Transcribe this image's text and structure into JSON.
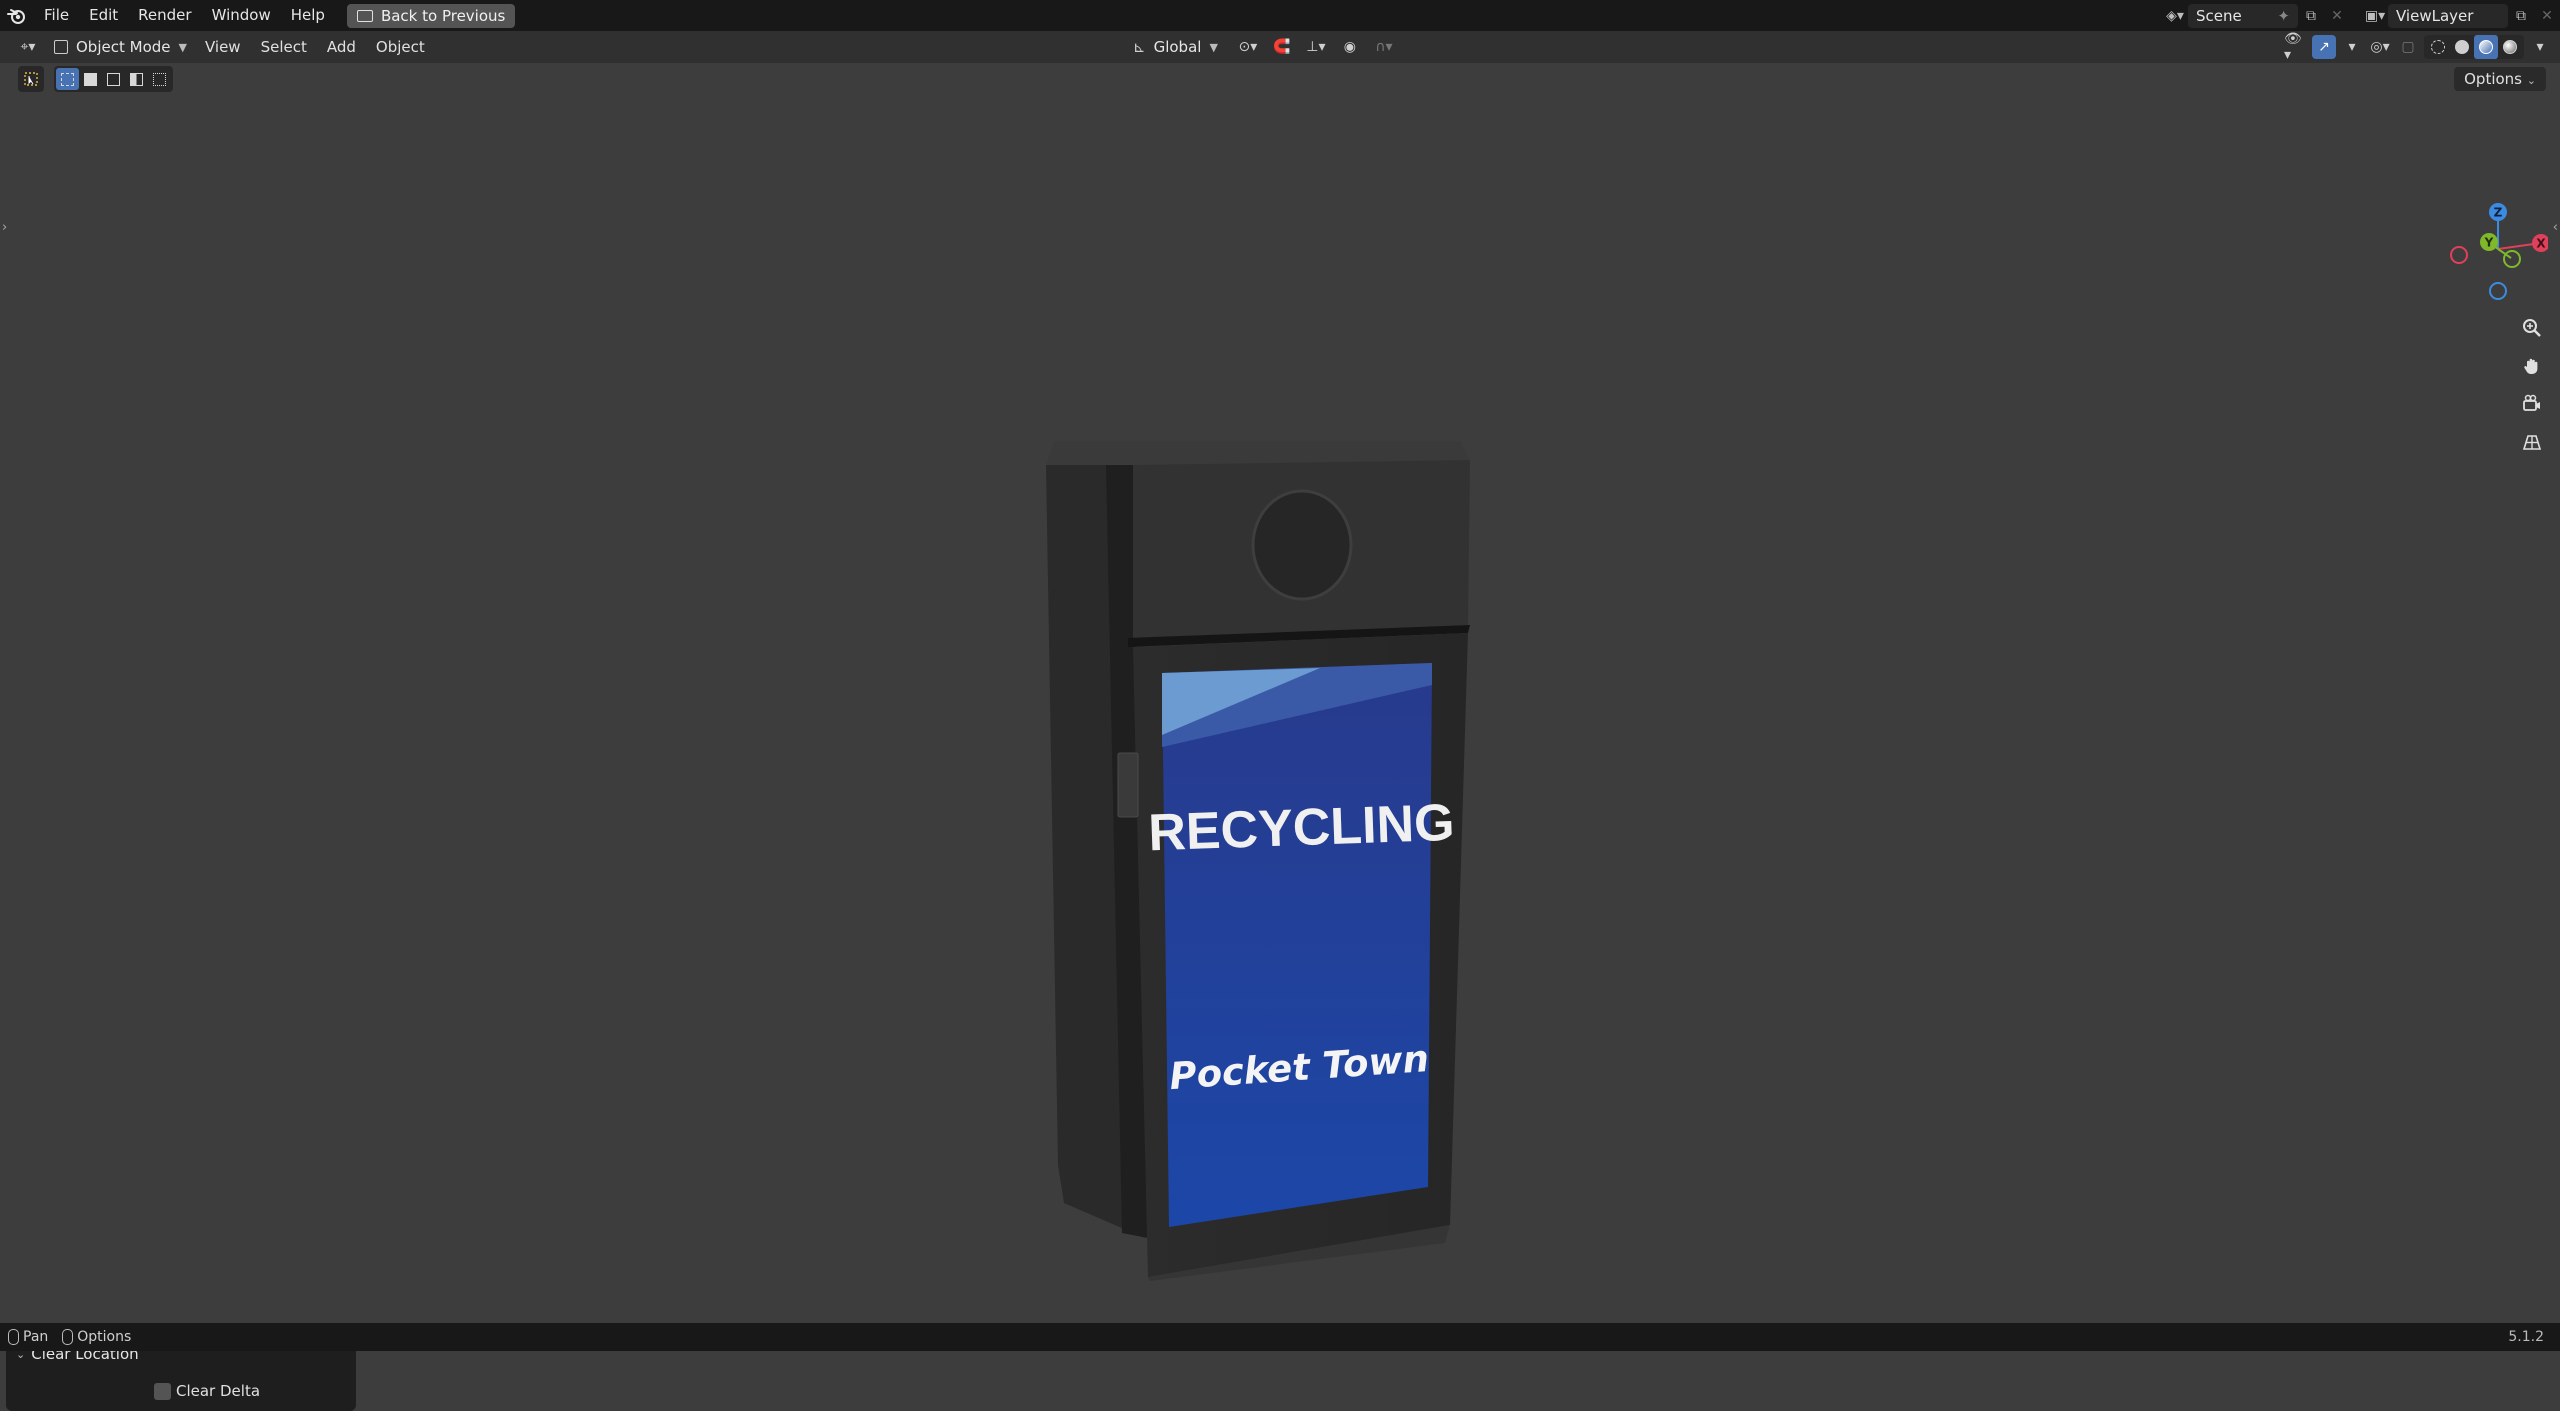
{
  "menubar": {
    "items": [
      "File",
      "Edit",
      "Render",
      "Window",
      "Help"
    ],
    "back_button": "Back to Previous",
    "scene": "Scene",
    "view_layer": "ViewLayer"
  },
  "header": {
    "mode": "Object Mode",
    "menus": [
      "View",
      "Select",
      "Add",
      "Object"
    ],
    "transform_orientation": "Global",
    "options": "Options"
  },
  "viewport": {
    "gizmo_axes": {
      "x": "X",
      "y": "Y",
      "z": "Z"
    },
    "model_labels": {
      "title": "RECYCLING",
      "subtitle": "Pocket Town"
    }
  },
  "operator_panel": {
    "title": "Clear Location",
    "checkbox_label": "Clear Delta",
    "checkbox_checked": false
  },
  "statusbar": {
    "pan": "Pan",
    "options": "Options",
    "version": "5.1.2"
  },
  "colors": {
    "accent": "#4772b3",
    "axis_x": "#e0405a",
    "axis_y": "#7fb82a",
    "axis_z": "#3d8be0",
    "viewport_bg": "#3d3d3d"
  }
}
